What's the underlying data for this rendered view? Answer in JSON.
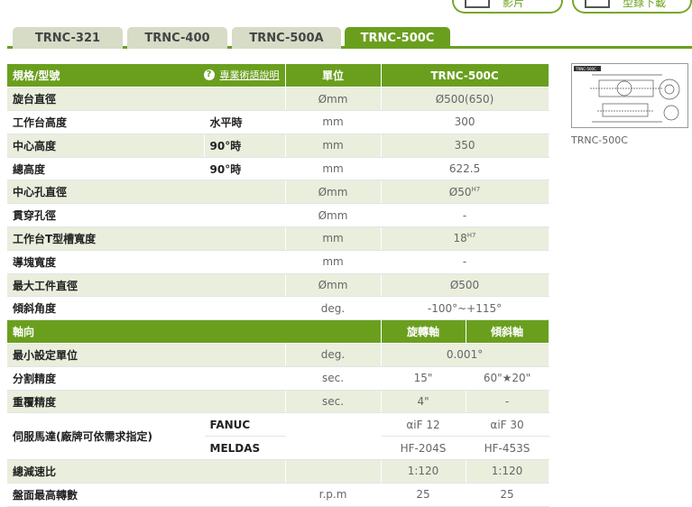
{
  "top_buttons": {
    "video": "影片",
    "download": "型錄下載"
  },
  "tabs": [
    {
      "label": "TRNC-321",
      "active": false
    },
    {
      "label": "TRNC-400",
      "active": false
    },
    {
      "label": "TRNC-500A",
      "active": false
    },
    {
      "label": "TRNC-500C",
      "active": true
    }
  ],
  "table": {
    "header": {
      "spec": "規格/型號",
      "help_link": "專業術語說明",
      "unit": "單位",
      "model": "TRNC-500C"
    },
    "rows1": [
      {
        "label": "旋台直徑",
        "unit": "Ømm",
        "value": "Ø500(650)"
      },
      {
        "label": "工作台高度",
        "sub": "水平時",
        "unit": "mm",
        "value": "300"
      },
      {
        "label": "中心高度",
        "sub": "90°時",
        "unit": "mm",
        "value": "350"
      },
      {
        "label": "總高度",
        "sub": "90°時",
        "unit": "mm",
        "value": "622.5"
      },
      {
        "label": "中心孔直徑",
        "unit": "Ømm",
        "value": "Ø50",
        "sup": "H7"
      },
      {
        "label": "貫穿孔徑",
        "unit": "Ømm",
        "value": "-"
      },
      {
        "label": "工作台T型槽寬度",
        "unit": "mm",
        "value": "18",
        "sup": "H7"
      },
      {
        "label": "導塊寬度",
        "unit": "mm",
        "value": "-"
      },
      {
        "label": "最大工件直徑",
        "unit": "Ømm",
        "value": "Ø500"
      },
      {
        "label": "傾斜角度",
        "unit": "deg.",
        "value": "-100°~+115°"
      }
    ],
    "axis_header": {
      "label": "軸向",
      "rotary": "旋轉軸",
      "tilt": "傾斜軸"
    },
    "row_min": {
      "label": "最小設定單位",
      "unit": "deg.",
      "value": "0.001°"
    },
    "row_div": {
      "label": "分割精度",
      "unit": "sec.",
      "rotary": "15\"",
      "tilt": "60\"★20\""
    },
    "row_rep": {
      "label": "重覆精度",
      "unit": "sec.",
      "rotary": "4\"",
      "tilt": "-"
    },
    "servo": {
      "label": "伺服馬達(廠牌可依需求指定)",
      "fanuc": {
        "brand": "FANUC",
        "rotary": "αiF 12",
        "tilt": "αiF 30"
      },
      "meldas": {
        "brand": "MELDAS",
        "rotary": "HF-204S",
        "tilt": "HF-453S"
      }
    },
    "row_ratio": {
      "label": "總減速比",
      "rotary": "1:120",
      "tilt": "1:120"
    },
    "row_rpm": {
      "label": "盤面最高轉數",
      "unit": "r.p.m",
      "rotary": "25",
      "tilt": "25"
    }
  },
  "thumbnail": {
    "caption": "TRNC-500C",
    "tag": "TRNC-500C"
  },
  "colors": {
    "green": "#6a9f1e",
    "shade": "#e9eedd",
    "tab_inactive": "#d6dcc6"
  }
}
